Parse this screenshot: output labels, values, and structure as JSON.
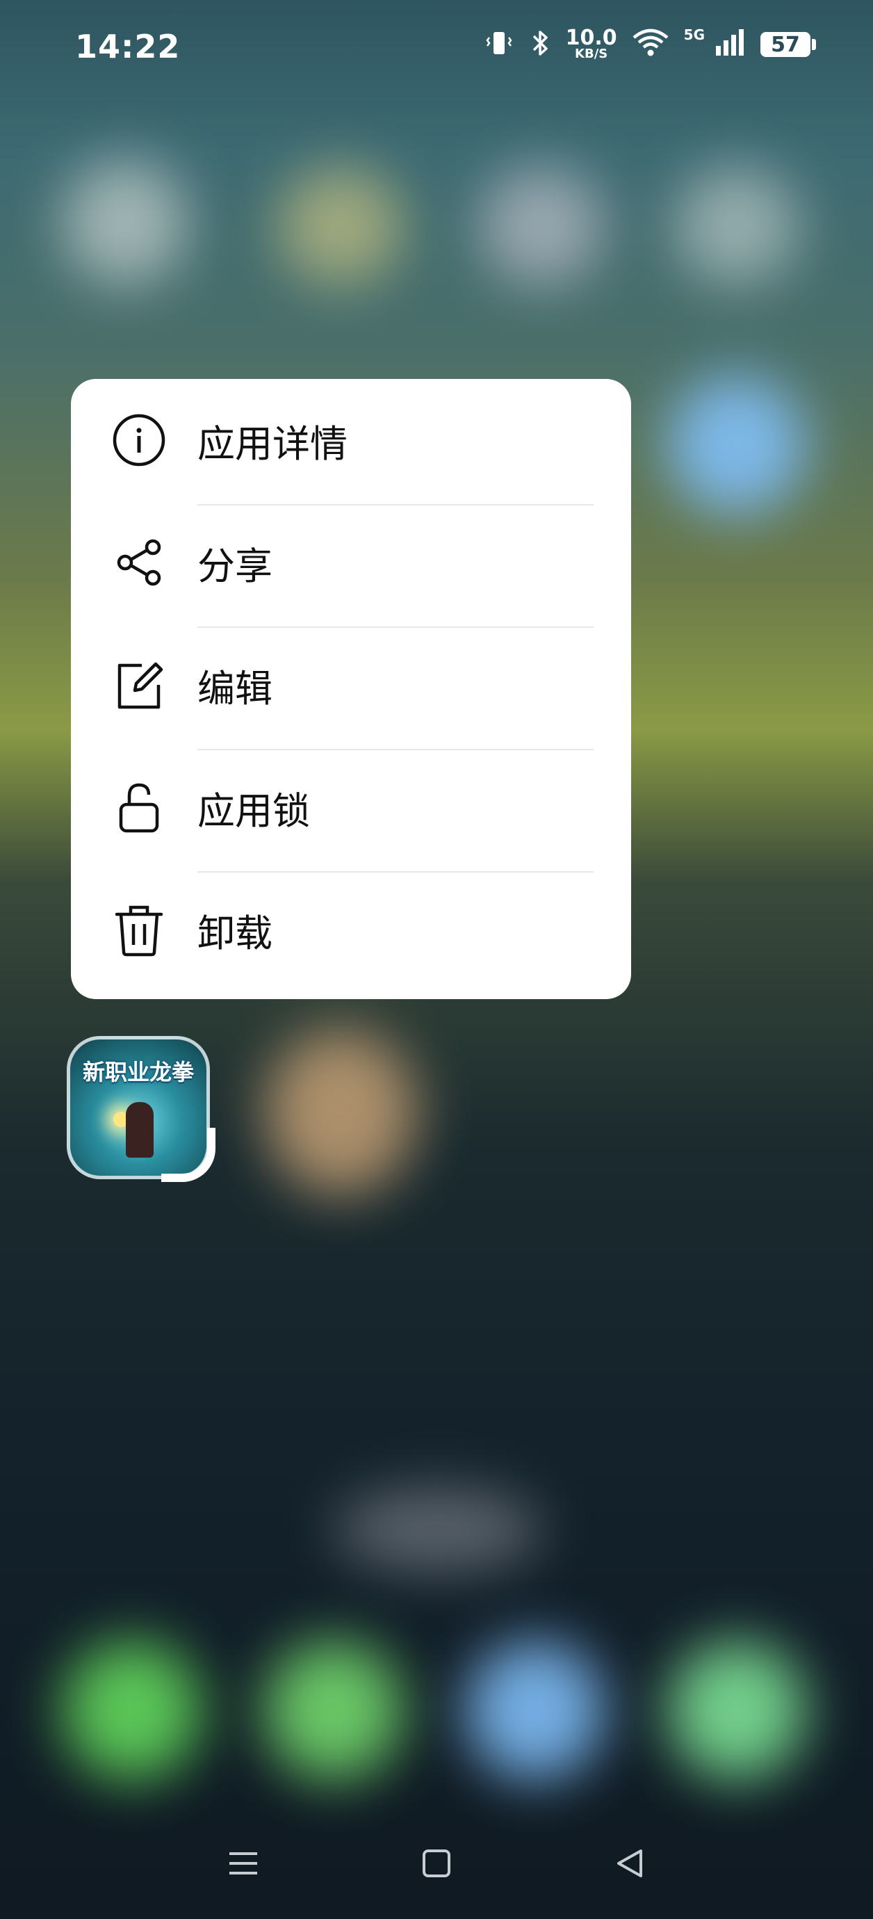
{
  "status_bar": {
    "time": "14:22",
    "net_speed_value": "10.0",
    "net_speed_unit": "KB/S",
    "network_type": "5G",
    "battery_level": "57",
    "icons": [
      "vibrate-icon",
      "bluetooth-icon",
      "wifi-icon",
      "signal-icon",
      "battery-icon"
    ]
  },
  "context_menu": {
    "items": [
      {
        "label": "应用详情",
        "icon": "info-icon"
      },
      {
        "label": "分享",
        "icon": "share-icon"
      },
      {
        "label": "编辑",
        "icon": "edit-icon"
      },
      {
        "label": "应用锁",
        "icon": "lock-icon"
      },
      {
        "label": "卸载",
        "icon": "trash-icon"
      }
    ]
  },
  "app": {
    "icon_title": "新职业龙拳"
  },
  "nav_bar": {
    "buttons": [
      "menu-icon",
      "home-icon",
      "back-icon"
    ]
  },
  "colors": {
    "menu_background": "#ffffff",
    "menu_text": "#111111",
    "divider": "#e8e8e8"
  }
}
